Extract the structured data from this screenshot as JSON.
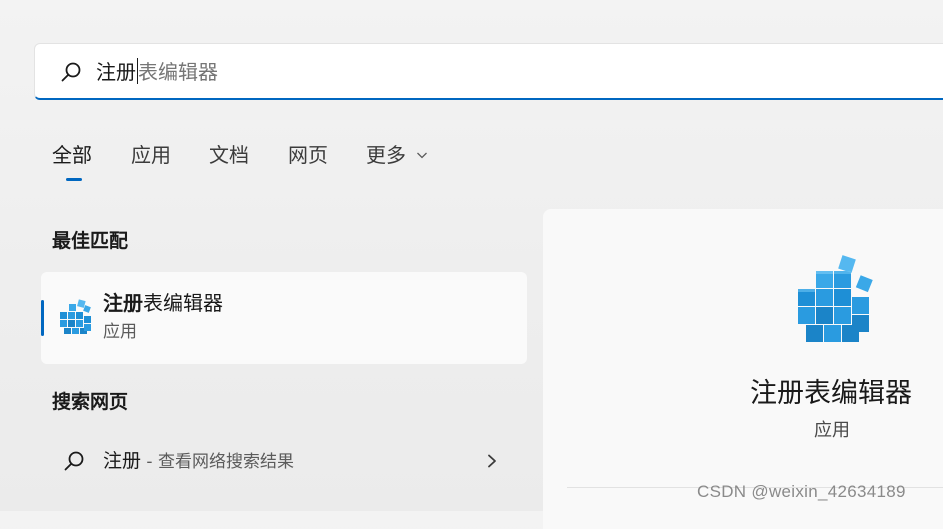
{
  "search": {
    "typed_text": "注册",
    "completion_text": "表编辑器"
  },
  "tabs": [
    {
      "label": "全部",
      "active": true
    },
    {
      "label": "应用",
      "active": false
    },
    {
      "label": "文档",
      "active": false
    },
    {
      "label": "网页",
      "active": false
    },
    {
      "label": "更多",
      "active": false,
      "has_dropdown": true
    }
  ],
  "best_match": {
    "heading": "最佳匹配",
    "title_bold": "注册",
    "title_rest": "表编辑器",
    "subtitle": "应用",
    "icon": "registry-editor-icon"
  },
  "web_search": {
    "heading": "搜索网页",
    "query": "注册",
    "separator": " - ",
    "hint": "查看网络搜索结果",
    "icon": "search-icon",
    "arrow_icon": "chevron-right-icon"
  },
  "detail": {
    "title": "注册表编辑器",
    "subtitle": "应用",
    "icon": "registry-editor-icon"
  },
  "watermark": "CSDN @weixin_42634189",
  "colors": {
    "accent": "#0067c0",
    "registry_blue": "#1e8fd6"
  }
}
